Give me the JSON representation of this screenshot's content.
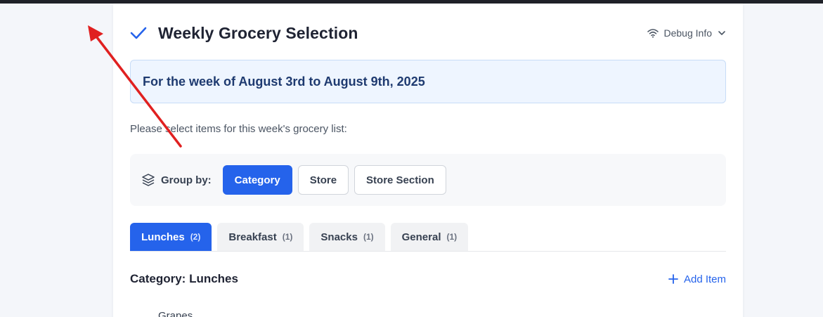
{
  "page": {
    "title": "Weekly Grocery Selection",
    "debug_label": "Debug Info",
    "week_banner": "For the week of August 3rd to August 9th, 2025",
    "instructions": "Please select items for this week's grocery list:"
  },
  "group_by": {
    "label": "Group by:",
    "options": [
      "Category",
      "Store",
      "Store Section"
    ],
    "selected": "Category"
  },
  "tabs": [
    {
      "label": "Lunches",
      "count": "(2)",
      "active": true
    },
    {
      "label": "Breakfast",
      "count": "(1)",
      "active": false
    },
    {
      "label": "Snacks",
      "count": "(1)",
      "active": false
    },
    {
      "label": "General",
      "count": "(1)",
      "active": false
    }
  ],
  "category": {
    "title": "Category: Lunches",
    "add_label": "Add Item",
    "items": [
      "Grapes"
    ]
  },
  "icons": {
    "title": "check-icon",
    "debug": "wifi-icon",
    "debug_toggle": "chevron-down-icon",
    "group_by": "layers-icon",
    "add": "plus-icon"
  },
  "colors": {
    "accent": "#2563eb",
    "banner_bg": "#eef5ff",
    "banner_text": "#1e3a70",
    "annotation_arrow": "#e02020"
  }
}
